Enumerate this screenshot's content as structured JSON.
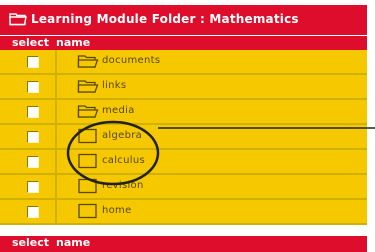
{
  "window": {
    "title": "Learning Module Folder : Mathematics"
  },
  "columns": {
    "select": "select",
    "name": "name"
  },
  "rows": [
    {
      "label": "documents",
      "icon": "open-folder-icon"
    },
    {
      "label": "links",
      "icon": "open-folder-icon"
    },
    {
      "label": "media",
      "icon": "open-folder-icon"
    },
    {
      "label": "algebra",
      "icon": "closed-folder-icon"
    },
    {
      "label": "calculus",
      "icon": "closed-folder-icon"
    },
    {
      "label": "revision",
      "icon": "closed-folder-icon"
    },
    {
      "label": "home",
      "icon": "closed-folder-icon"
    }
  ],
  "colors": {
    "header": "#dd0d2b",
    "row": "#f5c800",
    "text": "#5a4800",
    "callout": "#222222"
  }
}
